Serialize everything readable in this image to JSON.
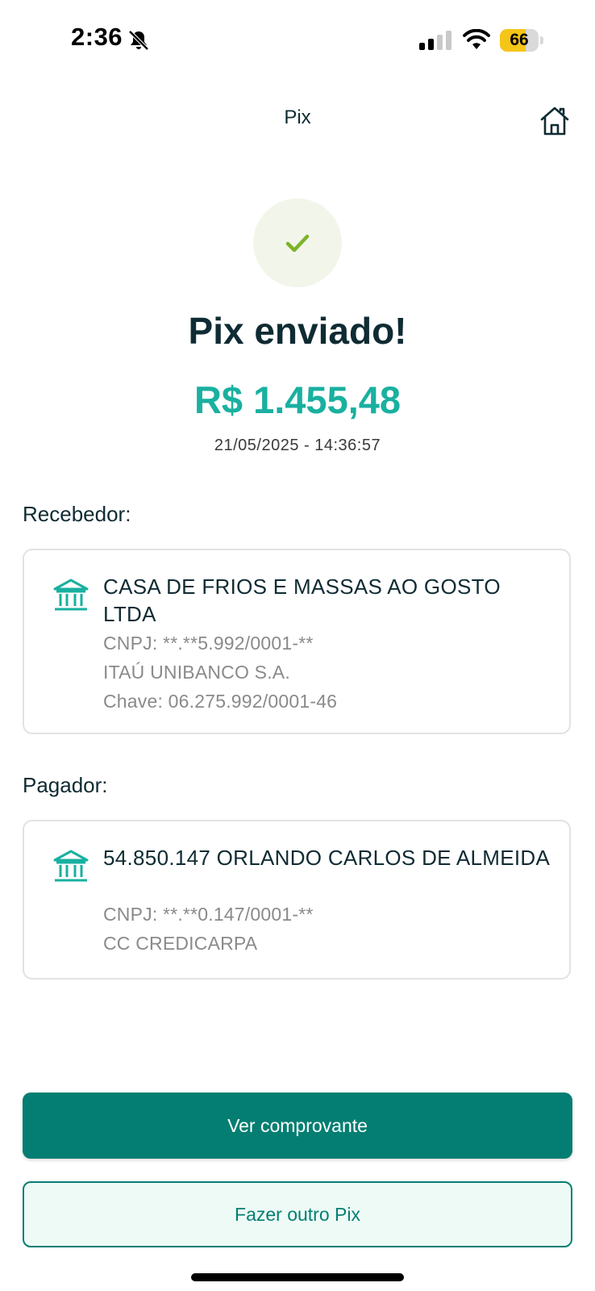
{
  "status_bar": {
    "time": "2:36",
    "battery_level": "66",
    "battery_fraction": 0.66,
    "battery_color": "#f5c518",
    "icons": [
      "bell-slash-icon",
      "signal-icon",
      "wifi-icon",
      "battery-icon"
    ]
  },
  "header": {
    "title": "Pix",
    "home_icon": "home-icon"
  },
  "result": {
    "icon": "check-icon",
    "title": "Pix enviado!",
    "amount": "R$ 1.455,48",
    "datetime": "21/05/2025 - 14:36:57"
  },
  "receiver": {
    "label": "Recebedor:",
    "icon": "bank-icon",
    "name": "CASA DE FRIOS E MASSAS AO GOSTO LTDA",
    "document": "CNPJ: **.**5.992/0001-**",
    "bank": "ITAÚ UNIBANCO S.A.",
    "key": "Chave: 06.275.992/0001-46"
  },
  "payer": {
    "label": "Pagador:",
    "icon": "bank-icon",
    "name": "54.850.147 ORLANDO CARLOS DE ALMEIDA",
    "document": "CNPJ: **.**0.147/0001-**",
    "account": "CC CREDICARPA"
  },
  "actions": {
    "primary_label": "Ver comprovante",
    "secondary_label": "Fazer outro Pix"
  },
  "colors": {
    "primary": "#047e72",
    "accent_amount": "#1ab0a0",
    "text_dark": "#0f2b33",
    "success_check": "#7cb32a"
  }
}
